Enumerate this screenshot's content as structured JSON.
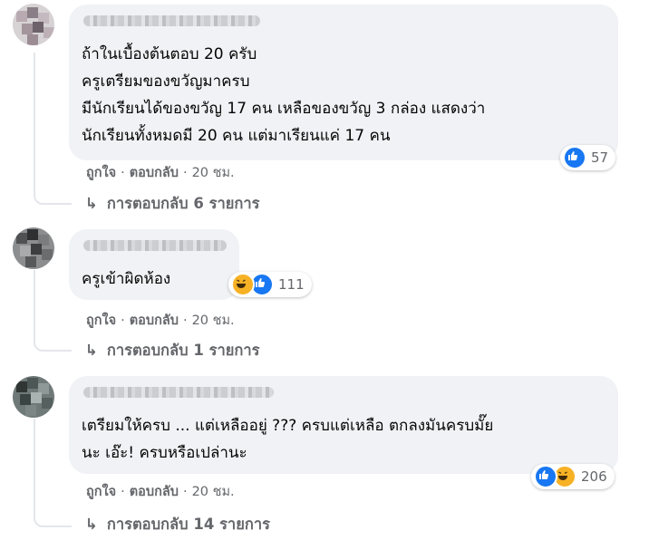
{
  "comments": [
    {
      "lines": [
        "ถ้าในเบื้องต้นตอบ 20 ครับ",
        "ครูเตรียมของขวัญมาครบ",
        "มีนักเรียนได้ของขวัญ 17 คน เหลือของขวัญ 3 กล่อง แสดงว่า",
        "นักเรียนทั้งหมดมี 20 คน แต่มาเรียนแค่ 17 คน"
      ],
      "like_label": "ถูกใจ",
      "reply_label": "ตอบกลับ",
      "time": "20 ชม.",
      "reaction_icons": [
        "like-icon"
      ],
      "reaction_count": "57",
      "replies_label": "การตอบกลับ 6 รายการ"
    },
    {
      "lines": [
        "ครูเข้าผิดห้อง"
      ],
      "like_label": "ถูกใจ",
      "reply_label": "ตอบกลับ",
      "time": "20 ชม.",
      "reaction_icons": [
        "haha-icon",
        "like-icon"
      ],
      "reaction_count": "111",
      "replies_label": "การตอบกลับ 1 รายการ"
    },
    {
      "lines": [
        "เตรียมให้ครบ ... แต่เหลืออยู่ ??? ครบแต่เหลือ ตกลงมันครบมั๊ย",
        "นะ เอ๊ะ! ครบหรือเปล่านะ"
      ],
      "like_label": "ถูกใจ",
      "reply_label": "ตอบกลับ",
      "time": "20 ชม.",
      "reaction_icons": [
        "like-icon",
        "haha-icon"
      ],
      "reaction_count": "206",
      "replies_label": "การตอบกลับ 14 รายการ"
    }
  ],
  "colors": {
    "bubble": "#f0f2f5",
    "meta_text": "#65676b",
    "like_blue": "#1877f2",
    "haha_yellow": "#f7b125"
  }
}
